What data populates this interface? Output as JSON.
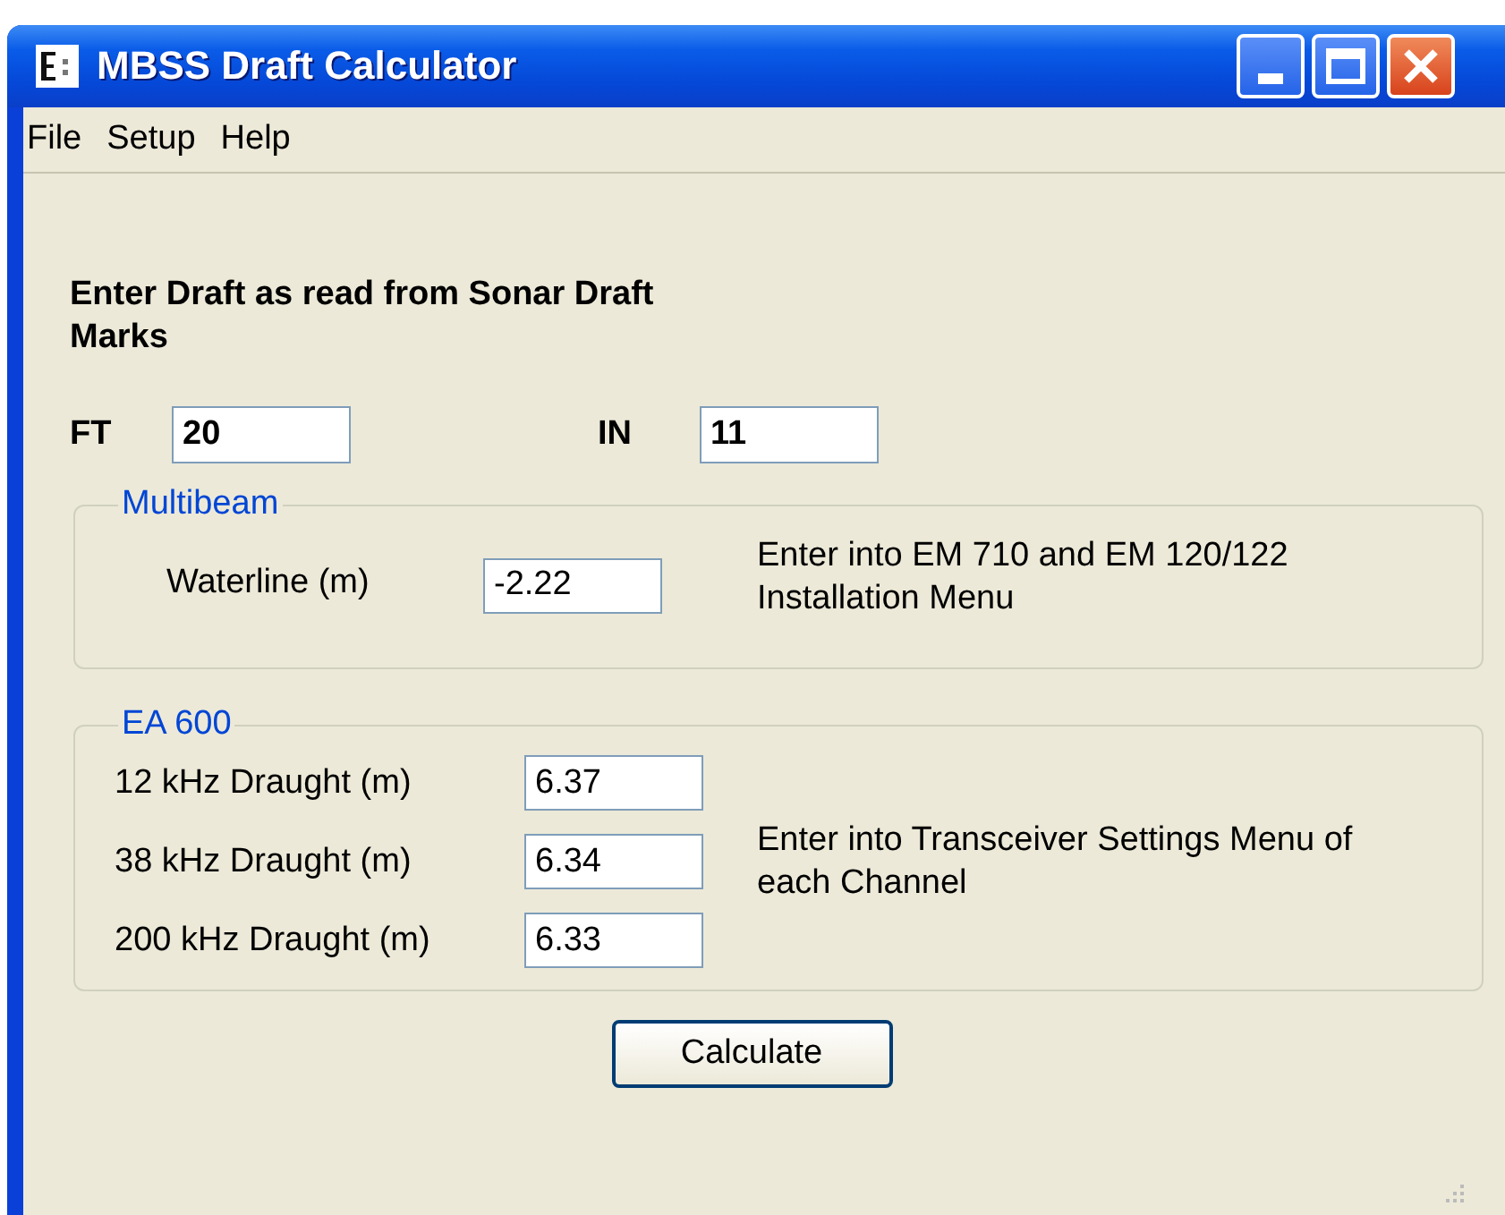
{
  "window": {
    "title": "MBSS Draft Calculator"
  },
  "menu": [
    {
      "label": "File"
    },
    {
      "label": "Setup"
    },
    {
      "label": "Help"
    }
  ],
  "instruction": "Enter Draft as read from Sonar Draft Marks",
  "draft": [
    {
      "label": "FT",
      "value": "20"
    },
    {
      "label": "IN",
      "value": "11"
    }
  ],
  "groups": [
    {
      "title": "Multibeam",
      "fields": [
        {
          "label": "Waterline (m)",
          "value": "-2.22"
        }
      ],
      "note": "Enter into EM 710 and EM 120/122 Installation Menu"
    },
    {
      "title": "EA 600",
      "fields": [
        {
          "label": "12 kHz Draught (m)",
          "value": "6.37"
        },
        {
          "label": "38 kHz Draught (m)",
          "value": "6.34"
        },
        {
          "label": "200 kHz Draught (m)",
          "value": "6.33"
        }
      ],
      "note": "Enter into Transceiver Settings Menu of each Channel"
    }
  ],
  "buttons": [
    "Calculate"
  ]
}
